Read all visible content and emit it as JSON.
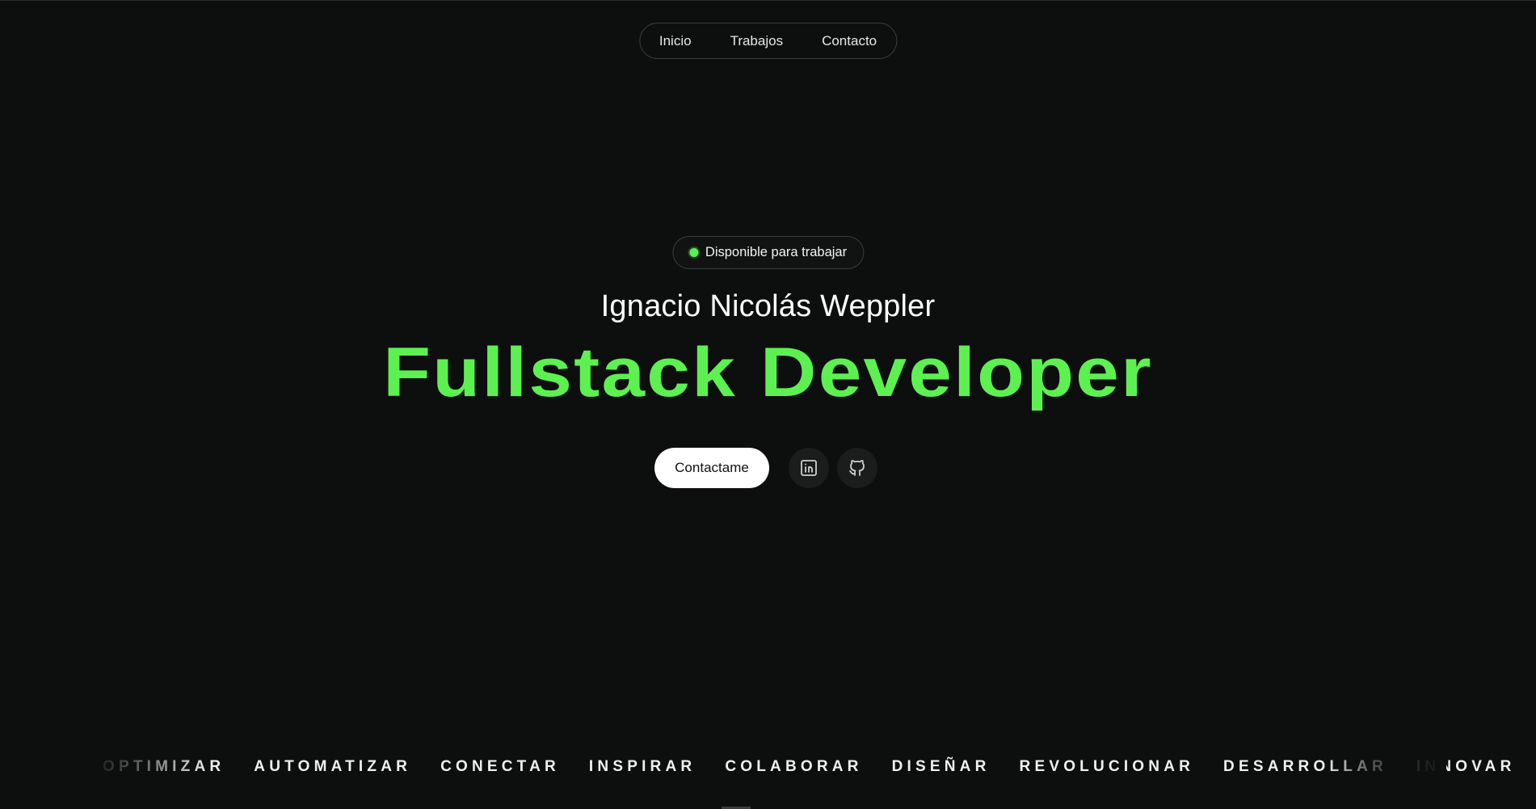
{
  "nav": {
    "items": [
      {
        "label": "Inicio"
      },
      {
        "label": "Trabajos"
      },
      {
        "label": "Contacto"
      }
    ]
  },
  "hero": {
    "status_badge": "Disponible para trabajar",
    "status_color": "#5cf150",
    "name": "Ignacio Nicolás Weppler",
    "role": "Fullstack Developer",
    "accent_color": "#5cf150",
    "contact_button": "Contactame",
    "social": [
      {
        "icon": "linkedin-icon"
      },
      {
        "icon": "github-icon"
      }
    ]
  },
  "marquee": {
    "words": [
      "OPTIMIZAR",
      "AUTOMATIZAR",
      "CONECTAR",
      "INSPIRAR",
      "COLABORAR",
      "DISEÑAR",
      "REVOLUCIONAR",
      "DESARROLLAR",
      "INNOVAR"
    ]
  },
  "theme": {
    "background": "#0d0f0e",
    "text": "#ffffff"
  }
}
